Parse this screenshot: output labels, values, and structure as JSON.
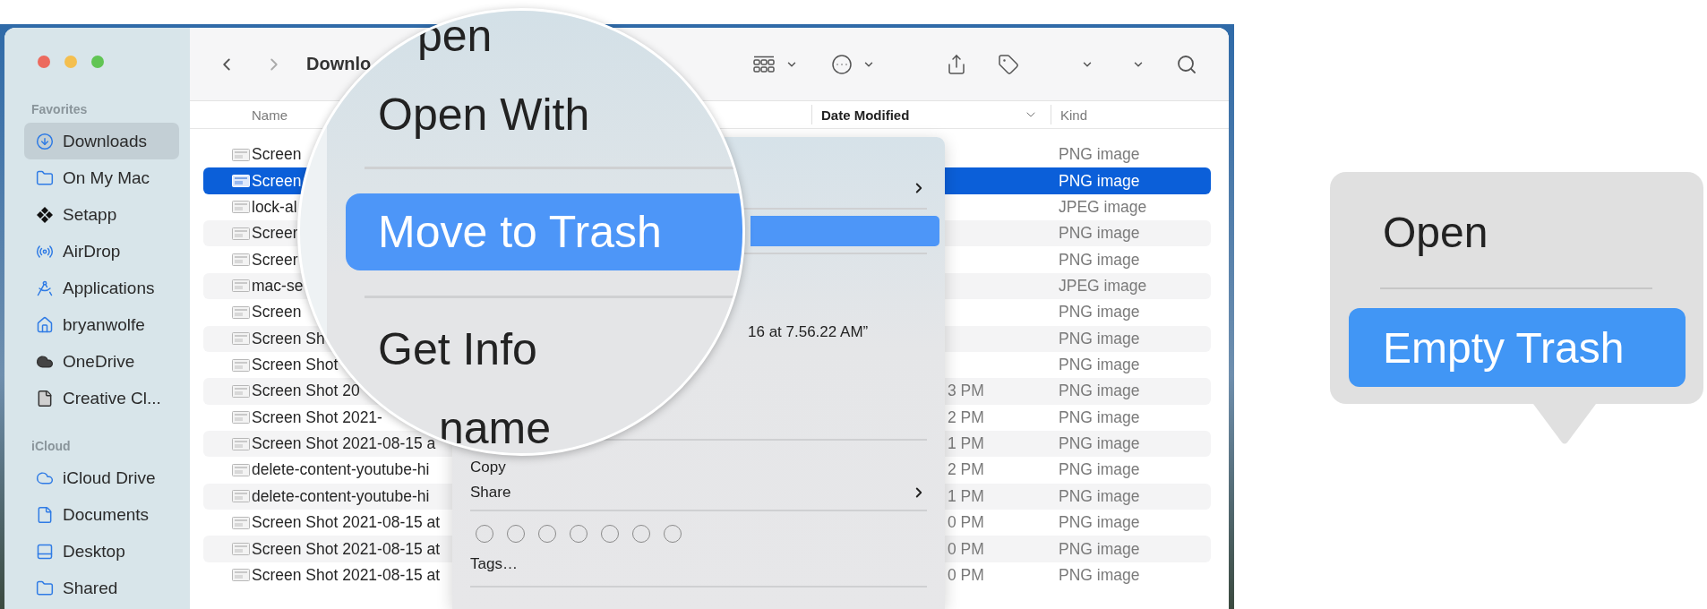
{
  "window": {
    "traffic_lights": [
      {
        "color": "#ec6a5e"
      },
      {
        "color": "#f4bf4f"
      },
      {
        "color": "#61c554"
      }
    ]
  },
  "sidebar": {
    "sections": [
      {
        "title": "Favorites",
        "items": [
          {
            "label": "Downloads",
            "selected": true
          },
          {
            "label": "On My Mac",
            "selected": false
          },
          {
            "label": "Setapp",
            "selected": false
          },
          {
            "label": "AirDrop",
            "selected": false
          },
          {
            "label": "Applications",
            "selected": false
          },
          {
            "label": "bryanwolfe",
            "selected": false
          },
          {
            "label": "OneDrive",
            "selected": false
          },
          {
            "label": "Creative Cl...",
            "selected": false
          }
        ]
      },
      {
        "title": "iCloud",
        "items": [
          {
            "label": "iCloud Drive",
            "selected": false
          },
          {
            "label": "Documents",
            "selected": false
          },
          {
            "label": "Desktop",
            "selected": false
          },
          {
            "label": "Shared",
            "selected": false
          }
        ]
      }
    ]
  },
  "toolbar": {
    "title": "Downlo"
  },
  "columns": {
    "name": "Name",
    "date": "Date Modified",
    "kind": "Kind"
  },
  "files": [
    {
      "name": "Screen",
      "kind": "PNG image",
      "selected": false
    },
    {
      "name": "Screen",
      "kind": "PNG image",
      "selected": true
    },
    {
      "name": "lock-al",
      "kind": "JPEG image",
      "selected": false
    },
    {
      "name": "Screer",
      "kind": "PNG image",
      "selected": false
    },
    {
      "name": "Screer",
      "kind": "PNG image",
      "selected": false
    },
    {
      "name": "mac-se",
      "kind": "JPEG image",
      "selected": false
    },
    {
      "name": "Screen",
      "kind": "PNG image",
      "selected": false
    },
    {
      "name": "Screen Sh",
      "kind": "PNG image",
      "selected": false
    },
    {
      "name": "Screen Shot",
      "kind": "PNG image",
      "selected": false
    },
    {
      "name": "Screen Shot 20",
      "date": "3 PM",
      "kind": "PNG image",
      "selected": false
    },
    {
      "name": "Screen Shot 2021-",
      "date": "2 PM",
      "kind": "PNG image",
      "selected": false
    },
    {
      "name": "Screen Shot 2021-08-15 a",
      "date": "1 PM",
      "kind": "PNG image",
      "selected": false
    },
    {
      "name": "delete-content-youtube-hi",
      "date": "2 PM",
      "kind": "PNG image",
      "selected": false
    },
    {
      "name": "delete-content-youtube-hi",
      "date": "1 PM",
      "kind": "PNG image",
      "selected": false
    },
    {
      "name": "Screen Shot 2021-08-15 at",
      "date": "0 PM",
      "kind": "PNG image",
      "selected": false
    },
    {
      "name": "Screen Shot 2021-08-15 at",
      "date": "0 PM",
      "kind": "PNG image",
      "selected": false
    },
    {
      "name": "Screen Shot 2021-08-15 at",
      "date": "0 PM",
      "kind": "PNG image",
      "selected": false
    }
  ],
  "context_menu": {
    "open_with_submenu": true,
    "trash_row_selected": true,
    "quick_look_fragment": "16 at 7.56.22 AM”",
    "items": [
      {
        "label": "Copy",
        "submenu": false
      },
      {
        "label": "Share",
        "submenu": true
      }
    ],
    "tags_label": "Tags…"
  },
  "magnifier": {
    "items": [
      {
        "label": "pen",
        "selected": false,
        "divider_above": false
      },
      {
        "label": "Open With",
        "selected": false,
        "divider_above": false
      },
      {
        "label": "Move to Trash",
        "selected": true,
        "divider_above": true
      },
      {
        "label": "Get Info",
        "selected": false,
        "divider_above": true
      },
      {
        "label": "name",
        "selected": false,
        "divider_above": false
      }
    ]
  },
  "dock_menu": {
    "items": [
      {
        "label": "Open",
        "selected": false
      },
      {
        "label": "Empty Trash",
        "selected": true
      }
    ]
  }
}
